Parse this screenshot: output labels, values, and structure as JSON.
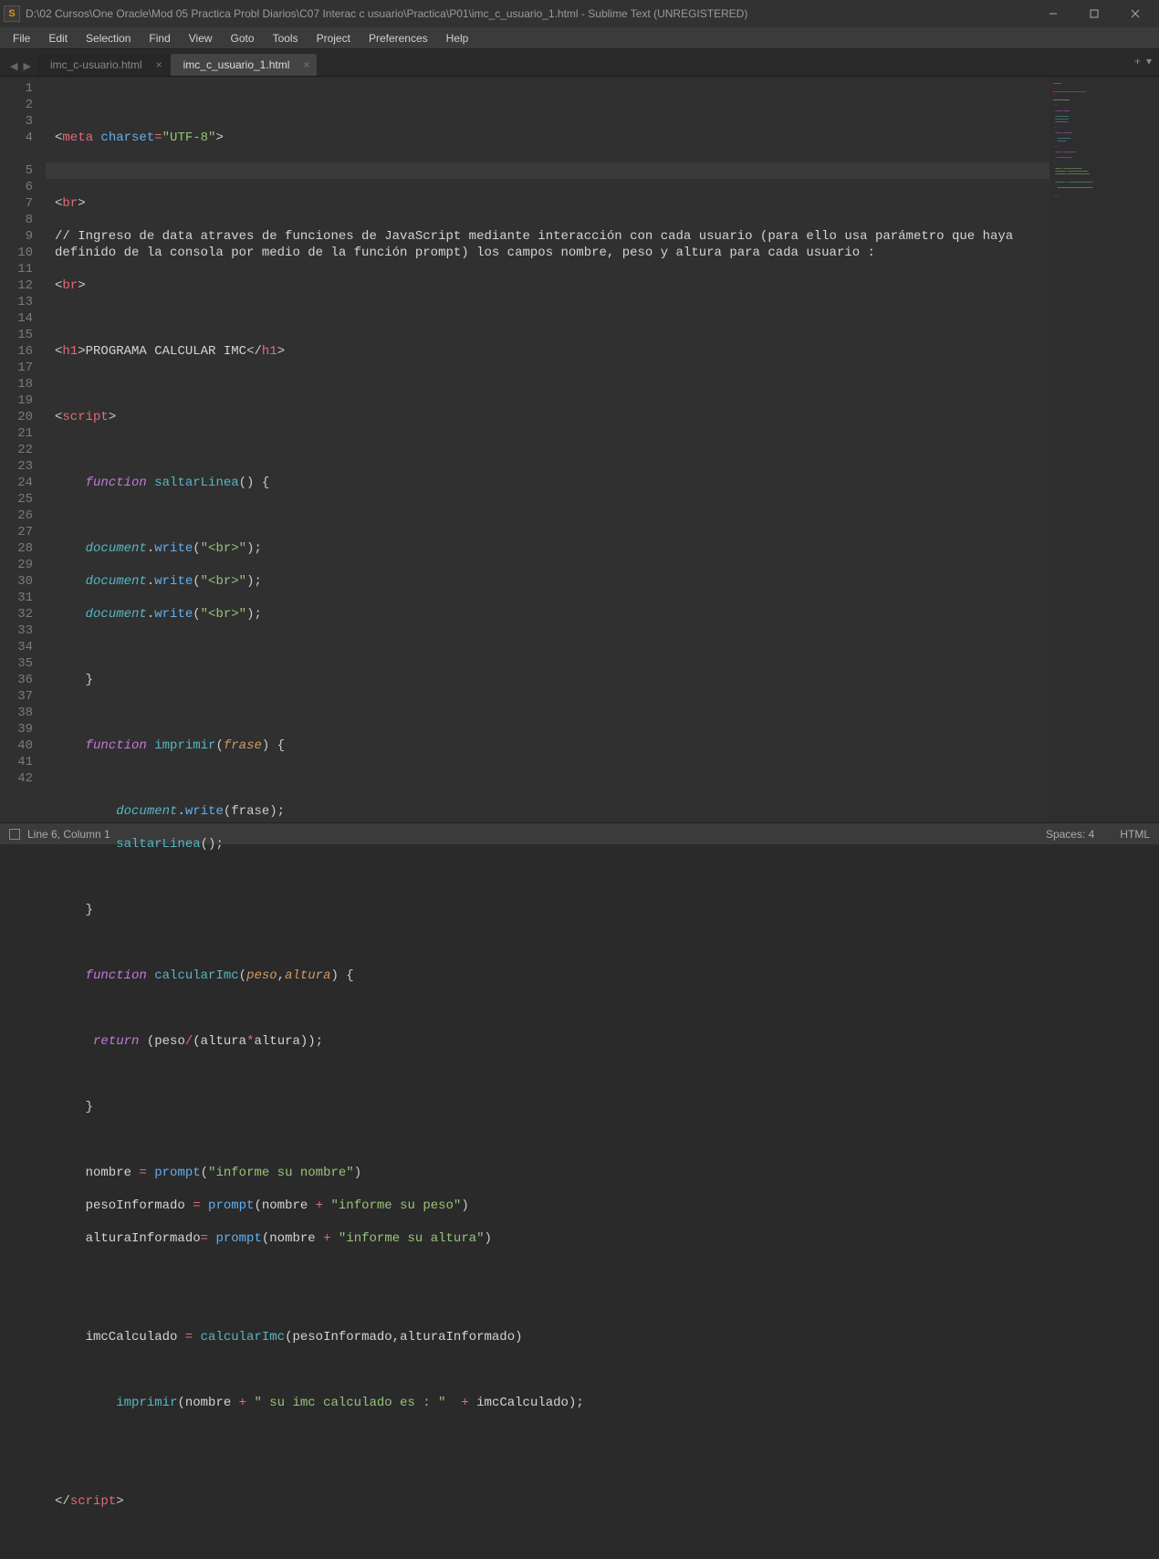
{
  "window": {
    "title": "D:\\02 Cursos\\One Oracle\\Mod 05 Practica Probl Diarios\\C07 Interac c usuario\\Practica\\P01\\imc_c_usuario_1.html - Sublime Text (UNREGISTERED)"
  },
  "menu": [
    "File",
    "Edit",
    "Selection",
    "Find",
    "View",
    "Goto",
    "Tools",
    "Project",
    "Preferences",
    "Help"
  ],
  "tabs": [
    {
      "label": "imc_c-usuario.html",
      "active": false
    },
    {
      "label": "imc_c_usuario_1.html",
      "active": true
    }
  ],
  "statusbar": {
    "position": "Line 6, Column 1",
    "spaces": "Spaces: 4",
    "syntax": "HTML"
  },
  "code": {
    "lines": 42,
    "l1": {
      "a": "<",
      "b": "meta",
      "c": " ",
      "d": "charset",
      "e": "=",
      "f": "\"UTF-8\"",
      "g": ">"
    },
    "l3": {
      "a": "<",
      "b": "br",
      "c": ">"
    },
    "l4": "// Ingreso de data atraves de funciones de JavaScript mediante interacción con cada usuario (para ello usa parámetro que haya definido de la consola por medio de la función prompt) los campos nombre, peso y altura para cada usuario :",
    "l5": {
      "a": "<",
      "b": "br",
      "c": ">"
    },
    "l7": {
      "a": "<",
      "b": "h1",
      "c": ">",
      "d": "PROGRAMA CALCULAR IMC",
      "e": "</",
      "f": "h1",
      "g": ">"
    },
    "l9": {
      "a": "<",
      "b": "script",
      "c": ">"
    },
    "l11": {
      "a": "    ",
      "b": "function",
      "c": " ",
      "d": "saltarLinea",
      "e": "() {"
    },
    "l13": {
      "a": "    ",
      "b": "document",
      "c": ".",
      "d": "write",
      "e": "(",
      "f": "\"<br>\"",
      "g": ");"
    },
    "l14": {
      "a": "    ",
      "b": "document",
      "c": ".",
      "d": "write",
      "e": "(",
      "f": "\"<br>\"",
      "g": ");"
    },
    "l15": {
      "a": "    ",
      "b": "document",
      "c": ".",
      "d": "write",
      "e": "(",
      "f": "\"<br>\"",
      "g": ");"
    },
    "l17": {
      "a": "    }"
    },
    "l19": {
      "a": "    ",
      "b": "function",
      "c": " ",
      "d": "imprimir",
      "e": "(",
      "f": "frase",
      "g": ") {"
    },
    "l21": {
      "a": "        ",
      "b": "document",
      "c": ".",
      "d": "write",
      "e": "(frase);"
    },
    "l22": {
      "a": "        ",
      "b": "saltarLinea",
      "c": "();"
    },
    "l24": {
      "a": "    }"
    },
    "l26": {
      "a": "    ",
      "b": "function",
      "c": " ",
      "d": "calcularImc",
      "e": "(",
      "f": "peso",
      "g": ",",
      "h": "altura",
      "i": ") {"
    },
    "l28": {
      "a": "     ",
      "b": "return",
      "c": " (peso",
      "d": "/",
      "e": "(altura",
      "f": "*",
      "g": "altura));"
    },
    "l30": {
      "a": "    }"
    },
    "l32": {
      "a": "    nombre ",
      "b": "=",
      "c": " ",
      "d": "prompt",
      "e": "(",
      "f": "\"informe su nombre\"",
      "g": ")"
    },
    "l33": {
      "a": "    pesoInformado ",
      "b": "=",
      "c": " ",
      "d": "prompt",
      "e": "(nombre ",
      "f": "+",
      "g": " ",
      "h": "\"informe su peso\"",
      "i": ")"
    },
    "l34": {
      "a": "    alturaInformado",
      "b": "=",
      "c": " ",
      "d": "prompt",
      "e": "(nombre ",
      "f": "+",
      "g": " ",
      "h": "\"informe su altura\"",
      "i": ")"
    },
    "l37": {
      "a": "    imcCalculado ",
      "b": "=",
      "c": " ",
      "d": "calcularImc",
      "e": "(pesoInformado,alturaInformado)"
    },
    "l39": {
      "a": "        ",
      "b": "imprimir",
      "c": "(nombre ",
      "d": "+",
      "e": " ",
      "f": "\" su imc calculado es : \"",
      "g": "  ",
      "h": "+",
      "i": " imcCalculado);"
    },
    "l42": {
      "a": "</",
      "b": "script",
      "c": ">"
    }
  }
}
